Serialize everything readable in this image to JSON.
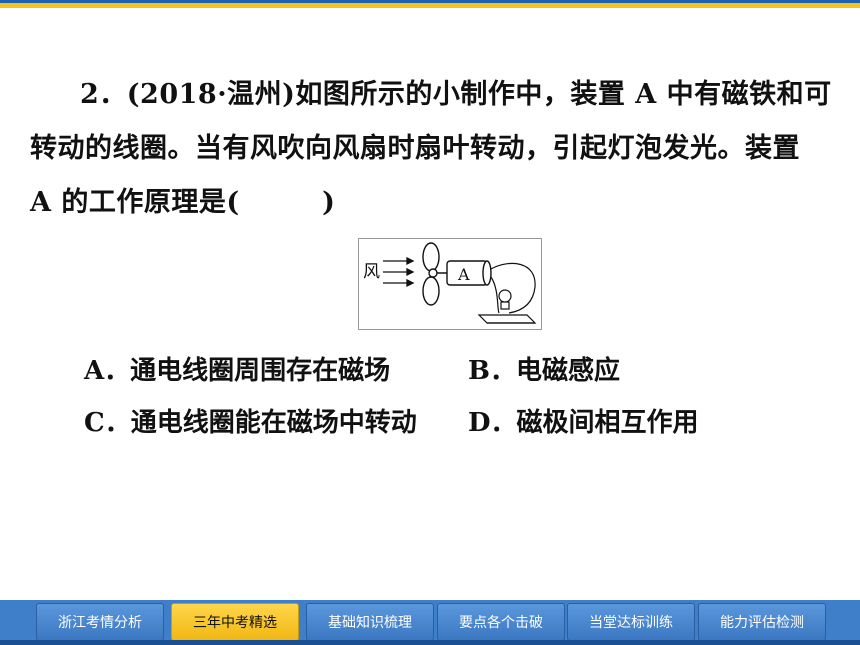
{
  "question": {
    "line1": "2．(2018·温州)如图所示的小制作中，装置 A 中有磁铁和可",
    "line2": "转动的线圈。当有风吹向风扇时扇叶转动，引起灯泡发光。装置",
    "line3": "A 的工作原理是(　　　)"
  },
  "figure": {
    "wind_label": "风",
    "device_label": "A"
  },
  "options": [
    {
      "text": "A．通电线圈周围存在磁场"
    },
    {
      "text": "B．电磁感应"
    },
    {
      "text": "C．通电线圈能在磁场中转动"
    },
    {
      "text": "D．磁极间相互作用"
    }
  ],
  "nav": {
    "tabs": [
      {
        "label": "浙江考情分析"
      },
      {
        "label": "三年中考精选",
        "active": true
      },
      {
        "label": "基础知识梳理"
      },
      {
        "label": "要点各个击破"
      },
      {
        "label": "当堂达标训练"
      },
      {
        "label": "能力评估检测"
      }
    ]
  },
  "colors": {
    "top_bar_blue": "#1f5fb0",
    "top_bar_yellow": "#f3c21c",
    "nav_blue": "#3f7fc9",
    "active_tab": "#f1b712"
  }
}
